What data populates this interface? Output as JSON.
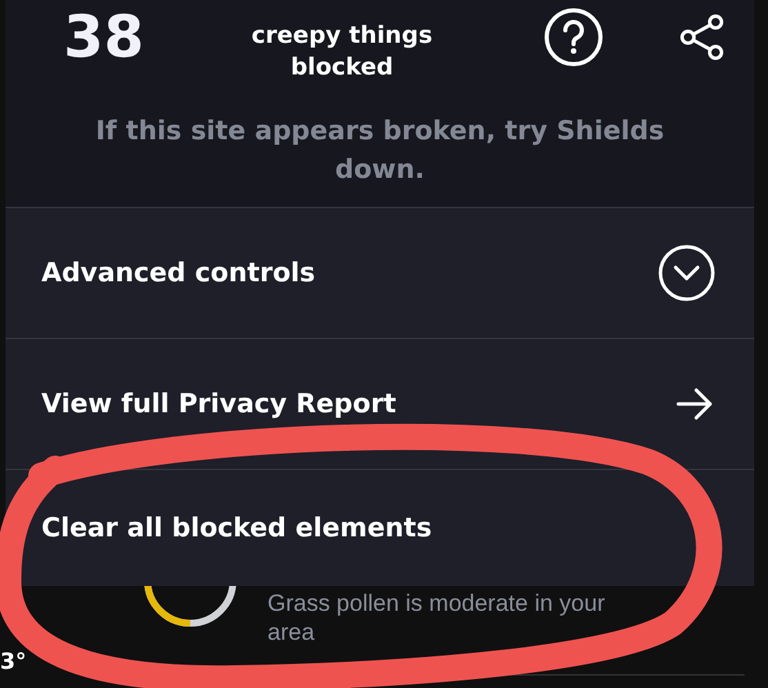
{
  "panel": {
    "count": "38",
    "count_caption": "creepy things blocked",
    "hint": "If this site appears broken, try Shields down.",
    "rows": [
      {
        "kind": "expand",
        "label": "Advanced controls",
        "expanded": false
      },
      {
        "kind": "link",
        "label": "View full Privacy Report"
      },
      {
        "kind": "plain",
        "label": "Clear all blocked elements"
      }
    ]
  },
  "background": {
    "temperature": "3°",
    "pollen_text": "Grass pollen is moderate in your area"
  },
  "annotation": {
    "kind": "circle",
    "color": "#ef5350"
  }
}
